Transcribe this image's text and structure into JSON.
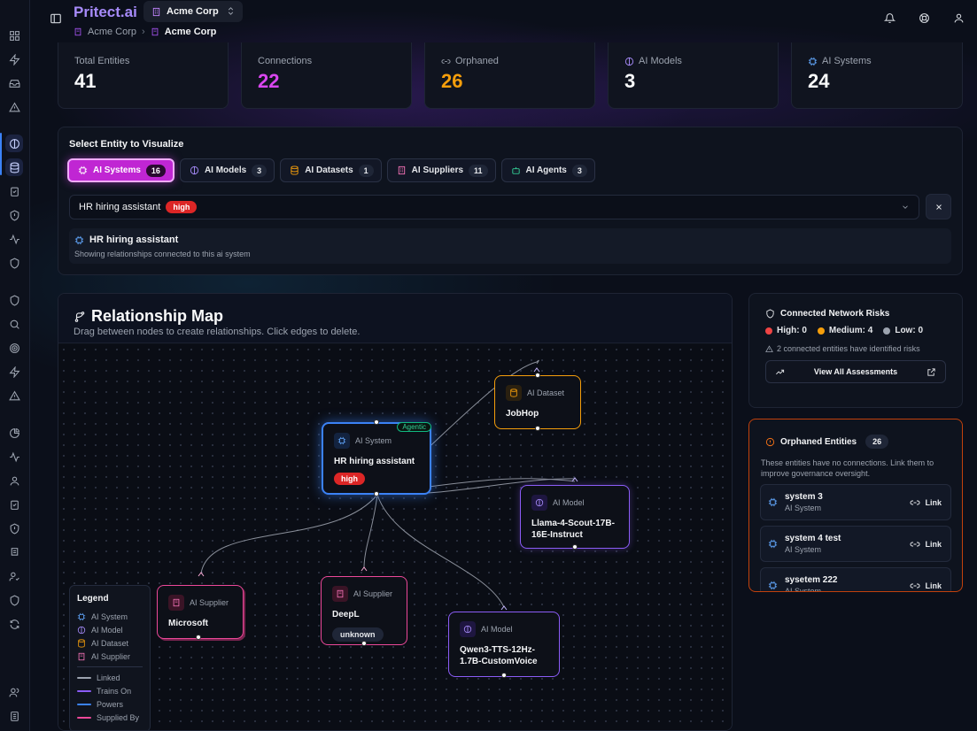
{
  "app": {
    "brand": "Pritect.ai"
  },
  "org": {
    "name": "Acme Corp"
  },
  "breadcrumb": [
    "Acme Corp",
    "Acme Corp"
  ],
  "stats": [
    {
      "label": "Total Entities",
      "value": "41",
      "color": "#f9fafb",
      "icon": ""
    },
    {
      "label": "Connections",
      "value": "22",
      "color": "#d946ef",
      "icon": ""
    },
    {
      "label": "Orphaned",
      "value": "26",
      "color": "#f59e0b",
      "icon": "unlink-icon"
    },
    {
      "label": "AI Models",
      "value": "3",
      "color": "#f9fafb",
      "icon": "brain-icon"
    },
    {
      "label": "AI Systems",
      "value": "24",
      "color": "#f9fafb",
      "icon": "cpu-icon"
    }
  ],
  "select": {
    "title": "Select Entity to Visualize",
    "chips": [
      {
        "label": "AI Systems",
        "count": "16",
        "icon": "cpu-icon",
        "color": "#60a5fa",
        "active": true
      },
      {
        "label": "AI Models",
        "count": "3",
        "icon": "brain-icon",
        "color": "#a78bfa",
        "active": false
      },
      {
        "label": "AI Datasets",
        "count": "1",
        "icon": "database-icon",
        "color": "#f59e0b",
        "active": false
      },
      {
        "label": "AI Suppliers",
        "count": "11",
        "icon": "building-icon",
        "color": "#f472b6",
        "active": false
      },
      {
        "label": "AI Agents",
        "count": "3",
        "icon": "bot-icon",
        "color": "#34d399",
        "active": false
      }
    ],
    "selected_value": "HR hiring assistant",
    "selected_badge": "high",
    "info_name": "HR hiring assistant",
    "info_desc": "Showing relationships connected to this ai system"
  },
  "map": {
    "title": "Relationship Map",
    "subtitle": "Drag between nodes to create relationships. Click edges to delete.",
    "nodes": {
      "hr": {
        "type": "AI System",
        "name": "HR hiring assistant",
        "badge": "high",
        "tag": "Agentic"
      },
      "jobhop": {
        "type": "AI Dataset",
        "name": "JobHop"
      },
      "llama": {
        "type": "AI Model",
        "name": "Llama-4-Scout-17B-16E-Instruct"
      },
      "microsoft": {
        "type": "AI Supplier",
        "name": "Microsoft"
      },
      "deepl": {
        "type": "AI Supplier",
        "name": "DeepL",
        "badge": "unknown"
      },
      "qwen": {
        "type": "AI Model",
        "name": "Qwen3-TTS-12Hz-1.7B-CustomVoice"
      }
    },
    "legend": {
      "title": "Legend",
      "entities": [
        {
          "label": "AI System",
          "icon": "cpu-icon",
          "color": "#60a5fa"
        },
        {
          "label": "AI Model",
          "icon": "brain-icon",
          "color": "#a78bfa"
        },
        {
          "label": "AI Dataset",
          "icon": "database-icon",
          "color": "#f59e0b"
        },
        {
          "label": "AI Supplier",
          "icon": "building-icon",
          "color": "#f472b6"
        }
      ],
      "edges": [
        {
          "label": "Linked",
          "color": "#9ca3af"
        },
        {
          "label": "Trains On",
          "color": "#8b5cf6"
        },
        {
          "label": "Powers",
          "color": "#3b82f6"
        },
        {
          "label": "Supplied By",
          "color": "#ec4899"
        }
      ]
    }
  },
  "risks": {
    "title": "Connected Network Risks",
    "high": "High: 0",
    "medium": "Medium: 4",
    "low": "Low: 0",
    "note": "2 connected entities have identified risks",
    "button": "View All Assessments"
  },
  "orphaned": {
    "title": "Orphaned Entities",
    "count": "26",
    "desc": "These entities have no connections. Link them to improve governance oversight.",
    "items": [
      {
        "name": "system 3",
        "type": "AI System",
        "action": "Link"
      },
      {
        "name": "system 4 test",
        "type": "AI System",
        "action": "Link"
      },
      {
        "name": "sysetem 222",
        "type": "AI System",
        "action": "Link"
      }
    ]
  }
}
